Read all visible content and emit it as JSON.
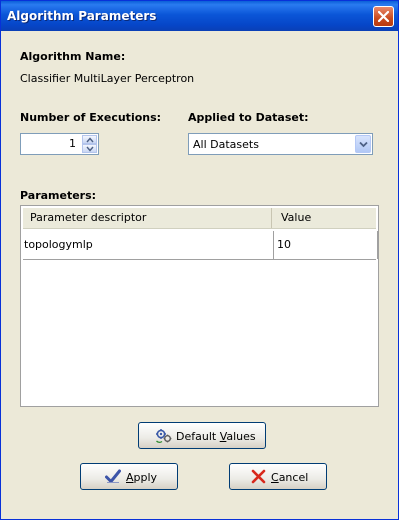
{
  "window": {
    "title": "Algorithm Parameters"
  },
  "algorithm": {
    "name_label": "Algorithm Name:",
    "name_value": "Classifier MultiLayer Perceptron"
  },
  "executions": {
    "label": "Number of Executions:",
    "value": "1"
  },
  "dataset": {
    "label": "Applied to Dataset:",
    "selected": "All Datasets"
  },
  "parameters": {
    "label": "Parameters:",
    "columns": [
      "Parameter descriptor",
      "Value"
    ],
    "rows": [
      [
        "topologymlp",
        "10"
      ]
    ]
  },
  "buttons": {
    "default_values": {
      "prefix": "Default ",
      "mnemonic": "V",
      "suffix": "alues"
    },
    "apply": {
      "prefix": "",
      "mnemonic": "A",
      "suffix": "pply"
    },
    "cancel": {
      "prefix": "",
      "mnemonic": "C",
      "suffix": "ancel"
    }
  },
  "icons": {
    "close": "close-icon",
    "spin_up": "arrow-up-icon",
    "spin_down": "arrow-down-icon",
    "dropdown": "chevron-down-icon",
    "default_values": "gears-refresh-icon",
    "apply": "checkmark-icon",
    "cancel": "x-mark-icon"
  },
  "colors": {
    "titlebar": "#0b56d8",
    "dialog_bg": "#ece9d8",
    "close_button": "#c84a1e",
    "apply_check": "#3c54a8",
    "cancel_x": "#d8281c"
  }
}
